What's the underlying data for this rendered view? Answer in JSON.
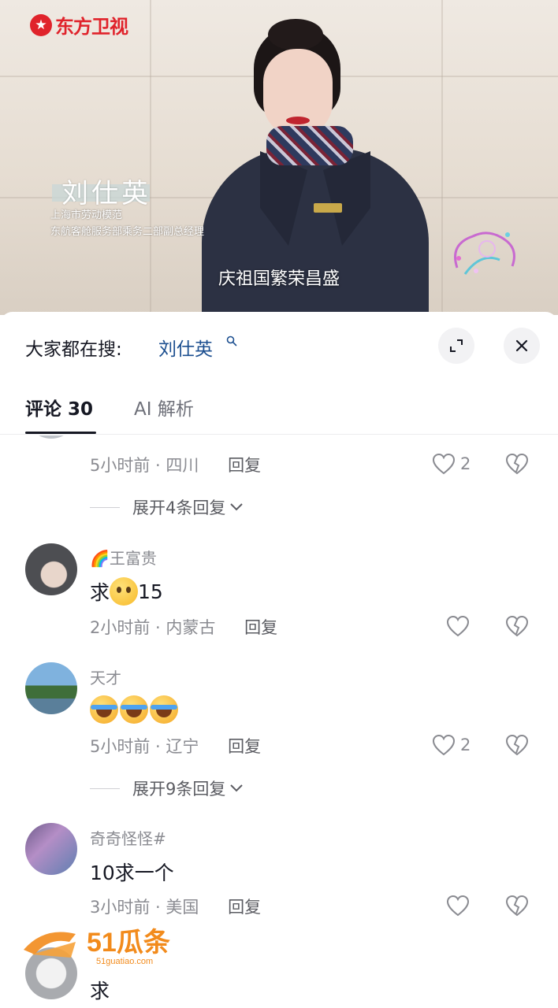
{
  "video": {
    "channel_logo": "东方卫视",
    "person_name": "刘仕英",
    "person_titles": [
      "上海市劳动模范",
      "东航客舱服务部乘务二部副总经理"
    ],
    "caption": "庆祖国繁荣昌盛"
  },
  "search": {
    "label": "大家都在搜:",
    "term": "刘仕英",
    "term_icon": "search-icon",
    "expand_icon": "expand-icon",
    "close_icon": "close-icon"
  },
  "tabs": [
    {
      "label": "评论 30",
      "active": true
    },
    {
      "label": "AI 解析",
      "active": false
    }
  ],
  "comments": [
    {
      "username": "",
      "content": "",
      "time": "5小时前",
      "location": "四川",
      "reply_label": "回复",
      "likes": "2",
      "expand_label": "展开4条回复"
    },
    {
      "username_prefix": "🌈",
      "username": "王富贵",
      "content": "求",
      "content_suffix": "15",
      "time": "2小时前",
      "location": "内蒙古",
      "reply_label": "回复",
      "likes": ""
    },
    {
      "username": "天才",
      "content": "",
      "time": "5小时前",
      "location": "辽宁",
      "reply_label": "回复",
      "likes": "2",
      "expand_label": "展开9条回复"
    },
    {
      "username": "奇奇怪怪#",
      "content": "10求一个",
      "time": "3小时前",
      "location": "美国",
      "reply_label": "回复",
      "likes": ""
    },
    {
      "username": "",
      "content": "求"
    }
  ],
  "watermark": {
    "main": "51瓜条",
    "sub": "51guatiao.com"
  },
  "colors": {
    "accent_link": "#1b4e8f",
    "text": "#161823",
    "muted": "#8a8b91",
    "logo_red": "#e0232b",
    "watermark_orange": "#f28b1c"
  }
}
